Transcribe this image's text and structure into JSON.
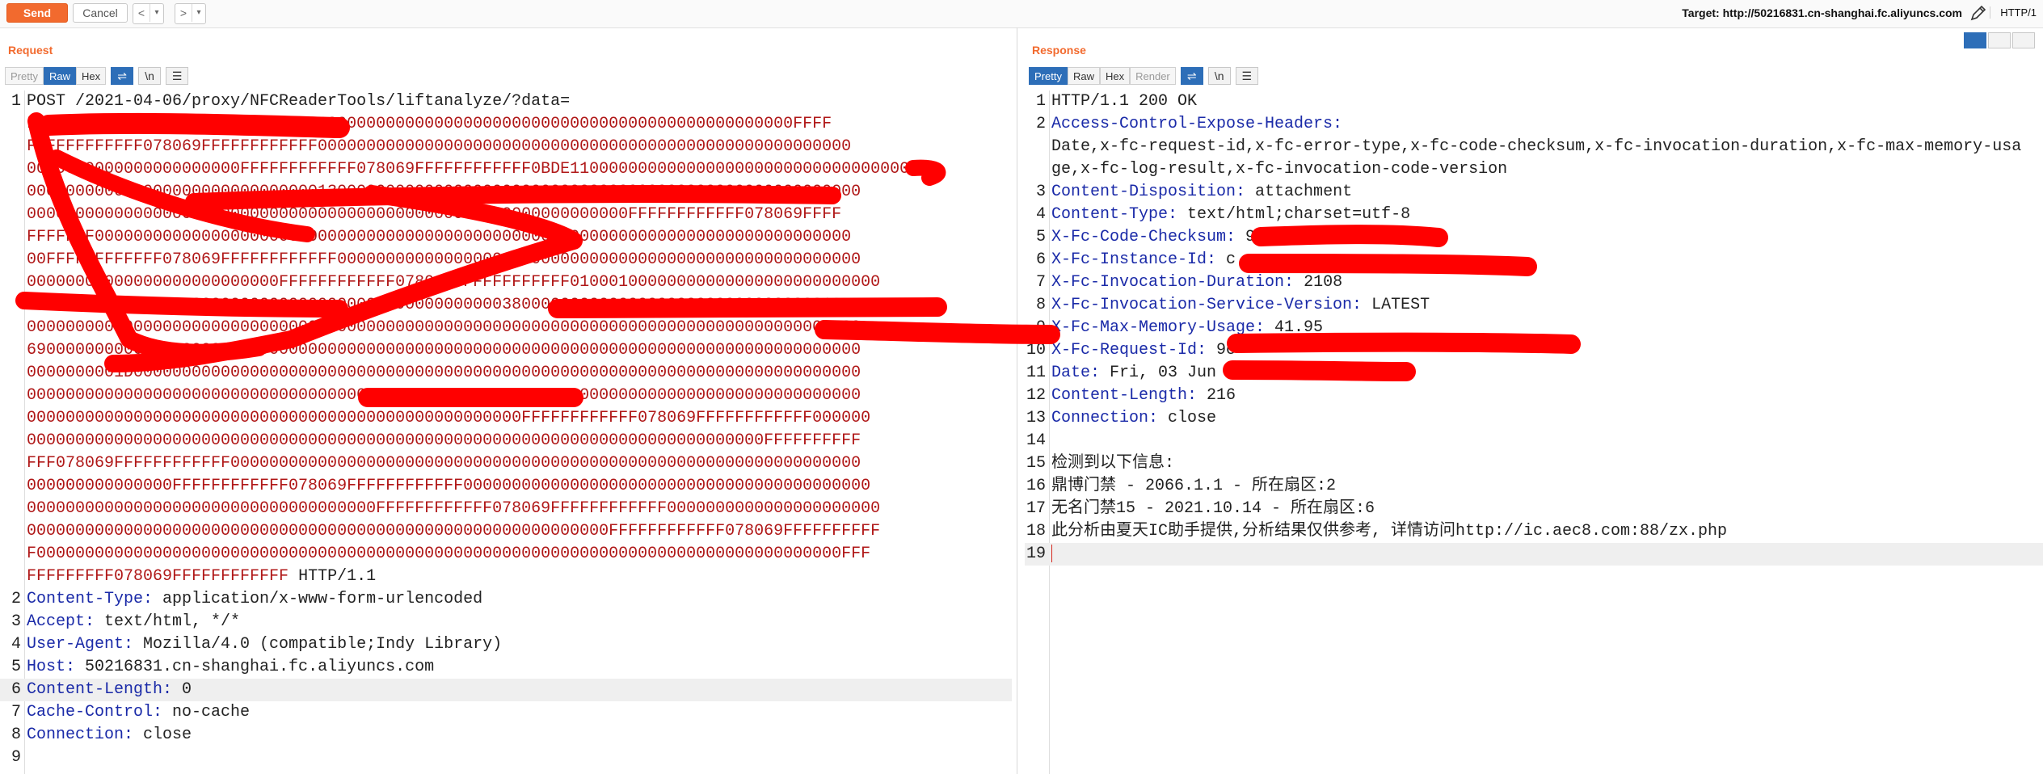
{
  "toolbar": {
    "send": "Send",
    "cancel": "Cancel",
    "back": "<",
    "forward": ">",
    "dropdown": "▾",
    "target_label": "Target: http://50216831.cn-shanghai.fc.aliyuncs.com",
    "protocol": "HTTP/1"
  },
  "request": {
    "title": "Request",
    "tabs": [
      "Pretty",
      "Raw",
      "Hex"
    ],
    "active_tab": "Raw",
    "tool_wrap": "⇌",
    "tool_newline": "\\n",
    "tool_menu": "☰",
    "request_line_prefix": "POST /2021-04-06/proxy/NFCReaderTools/liftanalyze/?data=",
    "data_lines": [
      "FFFFFFFFFFFF078069FFFFFFFFFFFF0000000000000000000000000000000000000000000000000FFFF",
      "FFFFFFFFFFFF078069FFFFFFFFFFFF0000000000000000000000000000000000000000000000000000000",
      "0000000000000000000000FFFFFFFFFFFF078069FFFFFFFFFFFF0BDE11000000000000000000000000000000000",
      "00000000000000000000000000000013000000000000000000000000000000000000000000000000000000",
      "00000000000000000000000000000000000000000000000000000000000000FFFFFFFFFFFF078069FFFF",
      "FFFFFFF000000000000000000000000000000000000000000000000000000000000000000000000000000",
      "00FFFFFFFFFFFF078069FFFFFFFFFFFF000000000000000000000000000000000000000000000000000000",
      "00000000000000000000000000FFFFFFFFFFFF078069FFFFFFFFFFFF01000100000000000000000000000000",
      "0000000000000000000000000000000000000000000000000380000000000000000000000000000000100000",
      "00000000000000000000000000000000000000000000000000000000000000000000000000000000000000",
      "69000000000000000000000000000000000000000000000000000000000000000000000000000000000000",
      "0000000001D000000000000000000000000000000000000000000000000000000000000000000000000000",
      "00000000000000000000000000000000000000000000000000000000000000000000000000000000000000",
      "000000000000000000000000000000000000000000000000000FFFFFFFFFFFF078069FFFFFFFFFFFF000000",
      "0000000000000000000000000000000000000000000000000000000000000000000000000000FFFFFFFFFF",
      "FFF078069FFFFFFFFFFFF00000000000000000000000000000000000000000000000000000000000000000",
      "000000000000000FFFFFFFFFFFF078069FFFFFFFFFFFF000000000000000000000000000000000000000000",
      "000000000000000000000000000000000000FFFFFFFFFFFF078069FFFFFFFFFFFF0000000000000000000000",
      "000000000000000000000000000000000000000000000000000000000000FFFFFFFFFFFF078069FFFFFFFFFF",
      "F00000000000000000000000000000000000000000000000000000000000000000000000000000000000FFF",
      "FFFFFFFFF078069FFFFFFFFFFFF"
    ],
    "request_line_suffix": " HTTP/1.1",
    "headers": [
      {
        "num": "2",
        "name": "Content-Type",
        "value": "application/x-www-form-urlencoded"
      },
      {
        "num": "3",
        "name": "Accept",
        "value": "text/html, */*"
      },
      {
        "num": "4",
        "name": "User-Agent",
        "value": "Mozilla/4.0 (compatible;Indy Library)"
      },
      {
        "num": "5",
        "name": "Host",
        "value": "50216831.cn-shanghai.fc.aliyuncs.com"
      },
      {
        "num": "6",
        "name": "Content-Length",
        "value": "0"
      },
      {
        "num": "7",
        "name": "Cache-Control",
        "value": "no-cache"
      },
      {
        "num": "8",
        "name": "Connection",
        "value": "close"
      }
    ],
    "last_line_num": "9"
  },
  "response": {
    "title": "Response",
    "tabs": [
      "Pretty",
      "Raw",
      "Hex",
      "Render"
    ],
    "active_tab": "Pretty",
    "status_line": "HTTP/1.1 200 OK",
    "headers": [
      {
        "num": "2",
        "name": "Access-Control-Expose-Headers",
        "value": ""
      },
      {
        "num": "3",
        "name": "Content-Disposition",
        "value": "attachment"
      },
      {
        "num": "4",
        "name": "Content-Type",
        "value": "text/html;charset=utf-8"
      },
      {
        "num": "5",
        "name": "X-Fc-Code-Checksum",
        "value": "958"
      },
      {
        "num": "6",
        "name": "X-Fc-Instance-Id",
        "value": "c"
      },
      {
        "num": "7",
        "name": "X-Fc-Invocation-Duration",
        "value": "2108"
      },
      {
        "num": "8",
        "name": "X-Fc-Invocation-Service-Version",
        "value": "LATEST"
      },
      {
        "num": "9",
        "name": "X-Fc-Max-Memory-Usage",
        "value": "41.95"
      },
      {
        "num": "10",
        "name": "X-Fc-Request-Id",
        "value": "9c"
      },
      {
        "num": "11",
        "name": "Date",
        "value": "Fri, 03 Jun 2022"
      },
      {
        "num": "12",
        "name": "Content-Length",
        "value": "216"
      },
      {
        "num": "13",
        "name": "Connection",
        "value": "close"
      }
    ],
    "expose_headers_value": "Date,x-fc-request-id,x-fc-error-type,x-fc-code-checksum,x-fc-invocation-duration,x-fc-max-memory-usage,x-fc-log-result,x-fc-invocation-code-version",
    "body_lines": [
      {
        "num": "14",
        "text": ""
      },
      {
        "num": "15",
        "text": "检测到以下信息:"
      },
      {
        "num": "16",
        "text": "鼎博门禁 - 2066.1.1 - 所在扇区:2"
      },
      {
        "num": "17",
        "text": "无名门禁15 - 2021.10.14 - 所在扇区:6"
      },
      {
        "num": "18",
        "text": "此分析由夏天IC助手提供,分析结果仅供参考, 详情访问http://ic.aec8.com:88/zx.php"
      },
      {
        "num": "19",
        "text": ""
      }
    ]
  }
}
